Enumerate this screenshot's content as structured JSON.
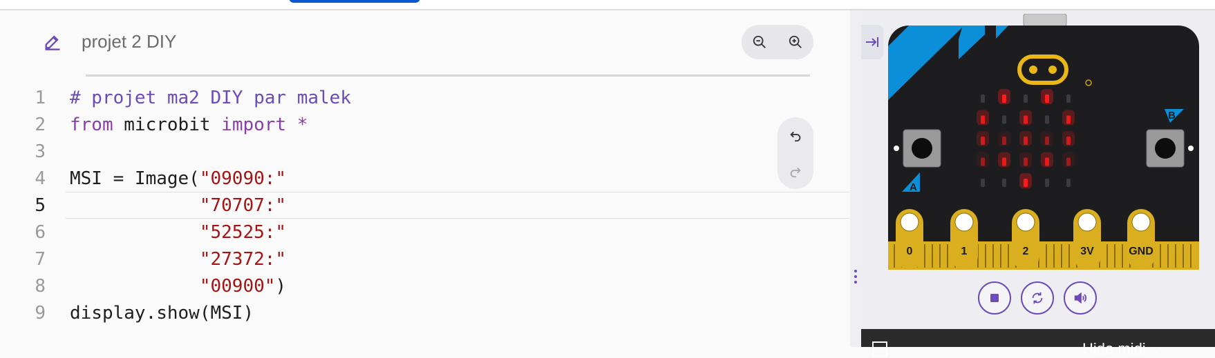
{
  "project": {
    "title": "projet 2 DIY"
  },
  "editor": {
    "line_numbers": [
      "1",
      "2",
      "3",
      "4",
      "5",
      "6",
      "7",
      "8",
      "9"
    ],
    "active_line": "5",
    "lines": [
      {
        "parts": [
          {
            "t": "# projet ma2 DIY par malek",
            "c": "cmt"
          }
        ]
      },
      {
        "parts": [
          {
            "t": "from",
            "c": "kw"
          },
          {
            "t": " microbit ",
            "c": ""
          },
          {
            "t": "import",
            "c": "kw"
          },
          {
            "t": " *",
            "c": "kw"
          }
        ]
      },
      {
        "parts": []
      },
      {
        "parts": [
          {
            "t": "MSI = Image(",
            "c": ""
          },
          {
            "t": "\"09090:\"",
            "c": "str"
          }
        ]
      },
      {
        "parts": [
          {
            "t": "            ",
            "c": ""
          },
          {
            "t": "\"70707:\"",
            "c": "str"
          }
        ]
      },
      {
        "parts": [
          {
            "t": "            ",
            "c": ""
          },
          {
            "t": "\"52525:\"",
            "c": "str"
          }
        ]
      },
      {
        "parts": [
          {
            "t": "            ",
            "c": ""
          },
          {
            "t": "\"27372:\"",
            "c": "str"
          }
        ]
      },
      {
        "parts": [
          {
            "t": "            ",
            "c": ""
          },
          {
            "t": "\"00900\"",
            "c": "str"
          },
          {
            "t": ")",
            "c": ""
          }
        ]
      },
      {
        "parts": [
          {
            "t": "display.show(MSI)",
            "c": ""
          }
        ]
      }
    ]
  },
  "icons": {
    "edit": "pencil-icon",
    "zoom_out": "zoom-out-icon",
    "zoom_in": "zoom-in-icon",
    "undo": "undo-icon",
    "redo": "redo-icon",
    "collapse": "collapse-right-icon",
    "stop": "stop-icon",
    "reset": "reset-icon",
    "sound": "sound-icon"
  },
  "simulator": {
    "pins": [
      "0",
      "1",
      "2",
      "3V",
      "GND"
    ],
    "button_a": "A",
    "button_b": "B",
    "led_levels": [
      [
        0,
        9,
        0,
        9,
        0
      ],
      [
        7,
        0,
        7,
        0,
        7
      ],
      [
        5,
        2,
        5,
        2,
        5
      ],
      [
        2,
        7,
        3,
        7,
        2
      ],
      [
        0,
        0,
        9,
        0,
        0
      ]
    ],
    "hide_bar_text": "Hide midi..."
  },
  "colors": {
    "accent": "#6c4bb8",
    "board_black": "#1d1d1f",
    "board_blue": "#0a8fd8",
    "pin_gold": "#d9ae1f",
    "led_on": "#ff1b1b",
    "string_red": "#a31515"
  }
}
